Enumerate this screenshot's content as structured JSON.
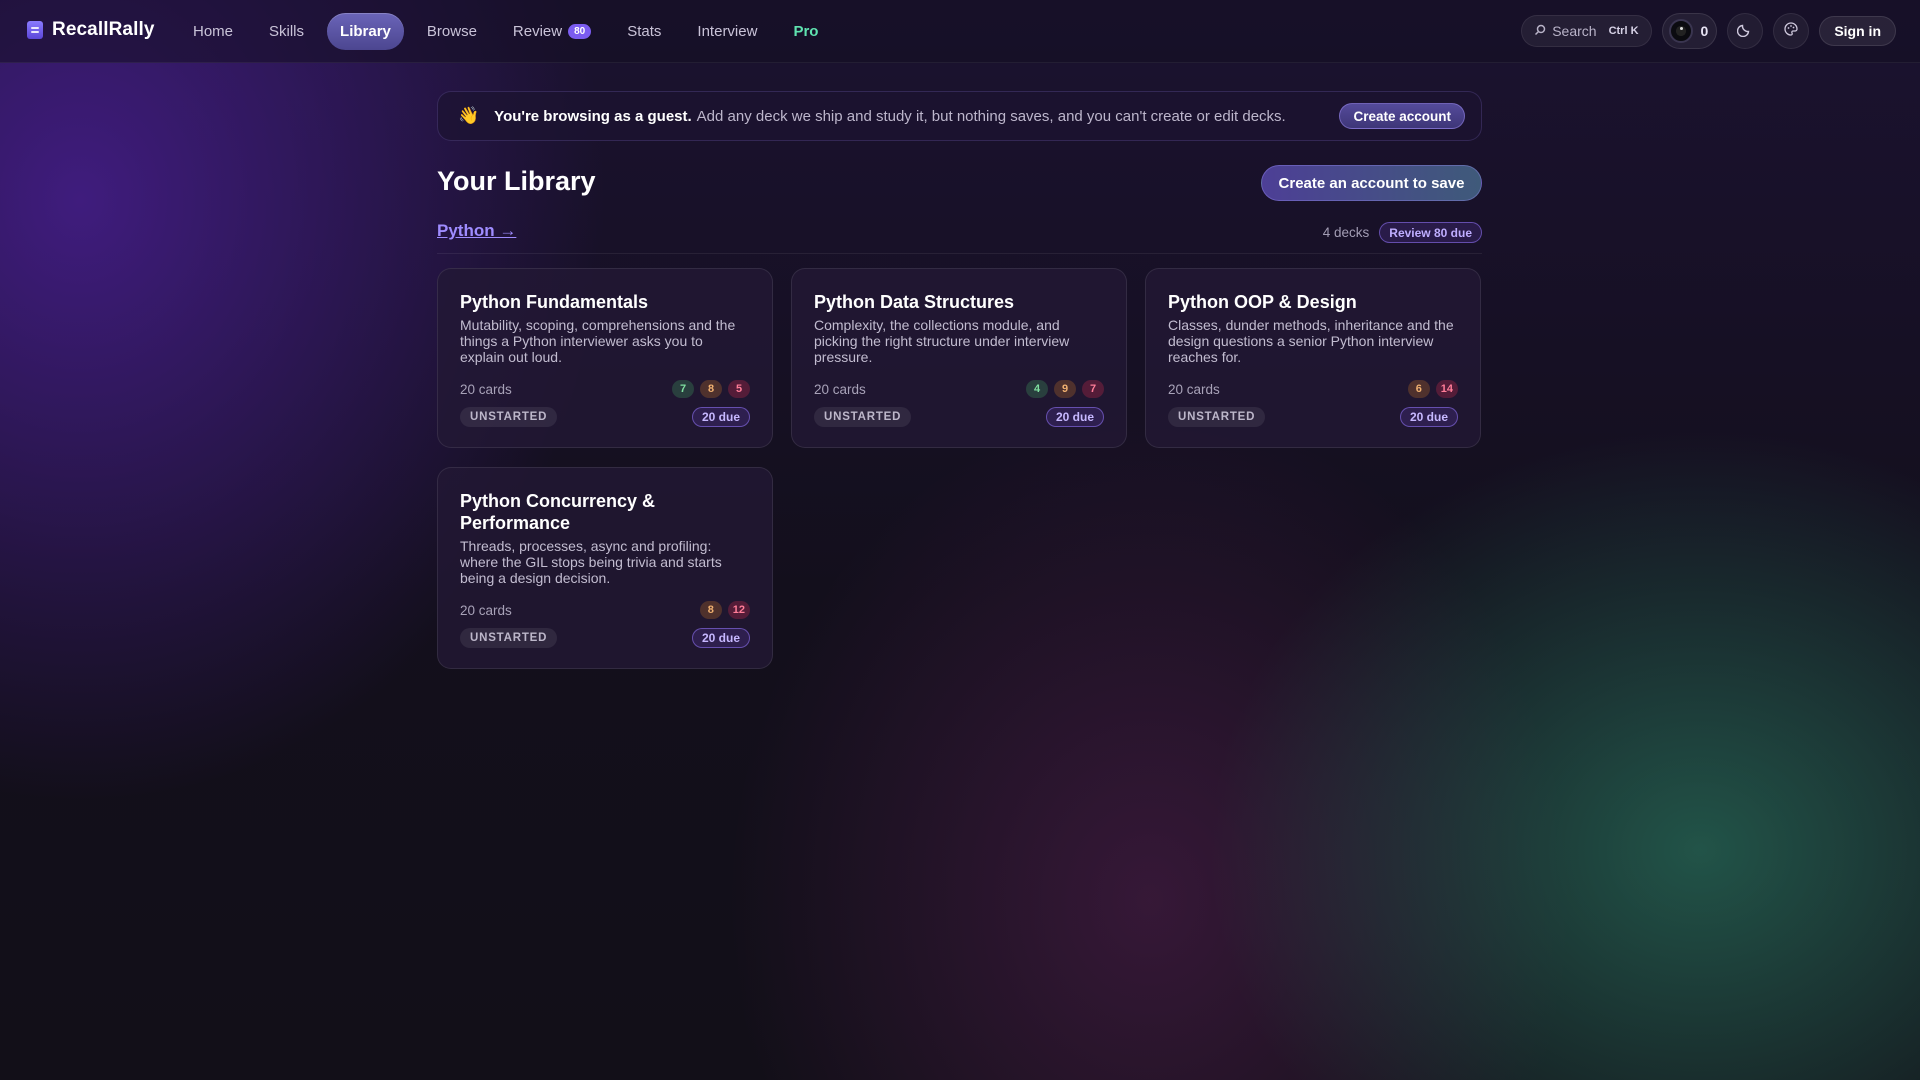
{
  "app": {
    "name": "RecallRally"
  },
  "nav": {
    "links": [
      {
        "label": "Home"
      },
      {
        "label": "Skills"
      },
      {
        "label": "Library"
      },
      {
        "label": "Browse"
      },
      {
        "label": "Review",
        "badge": "80"
      },
      {
        "label": "Stats"
      },
      {
        "label": "Interview"
      },
      {
        "label": "Pro"
      }
    ],
    "active": "Library",
    "search_label": "Search",
    "search_shortcut": "Ctrl K",
    "streak_count": "0",
    "signin_label": "Sign in",
    "icons": [
      "search-icon",
      "moon-icon",
      "palette-icon"
    ]
  },
  "banner": {
    "emoji": "👋",
    "bold": "You're browsing as a guest.",
    "text": "Add any deck we ship and study it, but nothing saves, and you can't create or edit decks.",
    "cta": "Create account"
  },
  "page": {
    "title": "Your Library",
    "save_cta": "Create an account to save"
  },
  "section": {
    "link": "Python →",
    "deck_count": "4 decks",
    "review_pill": "Review 80 due"
  },
  "decks": [
    {
      "title": "Python Fundamentals",
      "desc": "Mutability, scoping, comprehensions and the things a Python interviewer asks you to explain out loud.",
      "count": "20 cards",
      "difficulty": {
        "easy": "7",
        "medium": "8",
        "hard": "5"
      },
      "status": "UNSTARTED",
      "due": "20 due"
    },
    {
      "title": "Python Data Structures",
      "desc": "Complexity, the collections module, and picking the right structure under interview pressure.",
      "count": "20 cards",
      "difficulty": {
        "easy": "4",
        "medium": "9",
        "hard": "7"
      },
      "status": "UNSTARTED",
      "due": "20 due"
    },
    {
      "title": "Python OOP & Design",
      "desc": "Classes, dunder methods, inheritance and the design questions a senior Python interview reaches for.",
      "count": "20 cards",
      "difficulty": {
        "medium": "6",
        "hard": "14"
      },
      "status": "UNSTARTED",
      "due": "20 due"
    },
    {
      "title": "Python Concurrency & Performance",
      "desc": "Threads, processes, async and profiling: where the GIL stops being trivia and starts being a design decision.",
      "count": "20 cards",
      "difficulty": {
        "medium": "8",
        "hard": "12"
      },
      "status": "UNSTARTED",
      "due": "20 due"
    }
  ],
  "colors": {
    "accent": "#7b5cf0",
    "pro": "#5fe3b0",
    "easy": "#7fe0a0",
    "medium": "#f0b070",
    "hard": "#ff7d98"
  }
}
